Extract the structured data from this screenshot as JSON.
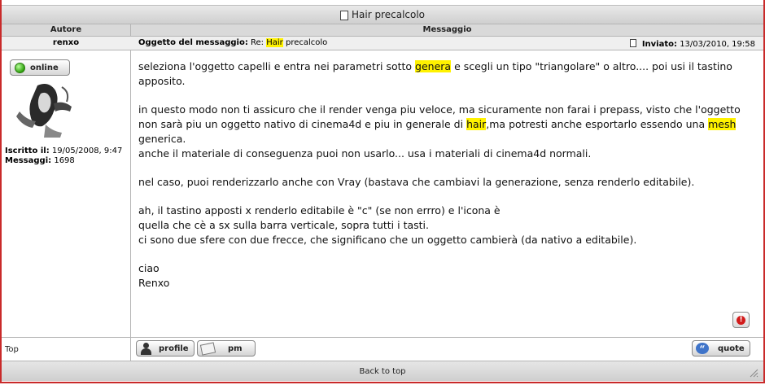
{
  "topic": {
    "title": "Hair precalcolo"
  },
  "columns": {
    "author": "Autore",
    "message": "Messaggio"
  },
  "post": {
    "author": "renxo",
    "subject_label": "Oggetto del messaggio:",
    "subject_prefix": "Re:",
    "subject_highlight": "Hair",
    "subject_rest": "precalcolo",
    "sent_label": "Inviato:",
    "sent_date": "13/03/2010, 19:58",
    "status": "online",
    "joined_label": "Iscritto il:",
    "joined_value": "19/05/2008, 9:47",
    "posts_label": "Messaggi:",
    "posts_value": "1698",
    "body": {
      "p1_a": "seleziona l'oggetto capelli e entra nei parametri sotto ",
      "p1_hl": "genera",
      "p1_b": " e scegli un tipo \"triangolare\" o altro.... poi usi il tastino apposito.",
      "p2_a": "in questo modo non ti assicuro che il render venga piu veloce, ma sicuramente non farai i prepass, visto che l'oggetto non sarà piu un oggetto nativo di cinema4d e piu in generale di ",
      "p2_hl1": "hair",
      "p2_b": ",ma potresti anche esportarlo essendo una ",
      "p2_hl2": "mesh",
      "p2_c": " generica.",
      "p2_line2": "anche il materiale di conseguenza puoi non usarlo... usa i materiali di cinema4d normali.",
      "p3": "nel caso, puoi renderizzarlo anche con Vray (bastava che cambiavi la generazione, senza renderlo editabile).",
      "p4_l1": "ah, il tastino apposti x renderlo editabile è \"c\" (se non errro) e l'icona è",
      "p4_l2": "quella che cè a sx sulla barra verticale, sopra tutti i tasti.",
      "p4_l3": "ci sono due sfere con due frecce, che significano che un oggetto cambierà (da nativo a editabile).",
      "sign_1": "ciao",
      "sign_2": "Renxo"
    }
  },
  "buttons": {
    "profile": "profile",
    "pm": "pm",
    "quote": "quote",
    "report": "!"
  },
  "links": {
    "top": "Top",
    "back_to_top": "Back to top"
  },
  "colors": {
    "highlight": "#fff200",
    "frame": "#c92a2a",
    "online": "#2ea10c",
    "quote_icon": "#3f74c9"
  }
}
